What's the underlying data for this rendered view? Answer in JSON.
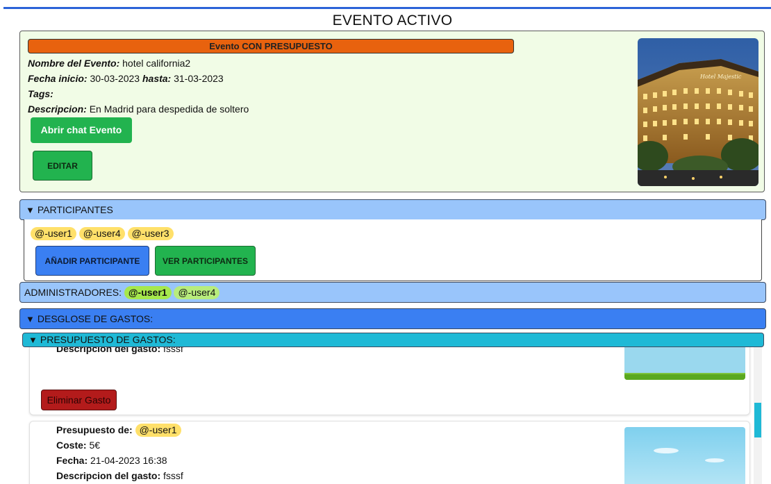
{
  "page_title": "EVENTO ACTIVO",
  "event": {
    "budget_banner": "Evento CON PRESUPUESTO",
    "name_label": "Nombre del Evento:",
    "name_value": "hotel california2",
    "start_label": "Fecha inicio:",
    "start_value": "30-03-2023",
    "end_label": "hasta:",
    "end_value": "31-03-2023",
    "tags_label": "Tags:",
    "desc_label": "Descripcion:",
    "desc_value": "En Madrid para despedida de soltero",
    "chat_button": "Abrir chat Evento",
    "edit_button": "EDITAR",
    "photo_sign": "Hotel Majestic"
  },
  "participants": {
    "header": "PARTICIPANTES",
    "users": [
      "@-user1",
      "@-user4",
      "@-user3"
    ],
    "add_button": "AÑADIR PARTICIPANTE",
    "see_button": "VER PARTICIPANTES"
  },
  "admins": {
    "label": "ADMINISTRADORES:",
    "users": [
      "@-user1",
      "@-user4"
    ]
  },
  "expenses": {
    "breakdown_header": "DESGLOSE DE GASTOS:",
    "budget_header": "PRESUPUESTO DE GASTOS:",
    "card1": {
      "desc_label": "Descripcion del gasto:",
      "desc_value": "fsssf",
      "delete_button": "Eliminar Gasto"
    },
    "card2": {
      "budget_label": "Presupuesto de:",
      "budget_user": "@-user1",
      "cost_label": "Coste:",
      "cost_value": "5€",
      "date_label": "Fecha:",
      "date_value": "21-04-2023 16:38",
      "desc_label": "Descripcion del gasto:",
      "desc_value": "fsssf"
    }
  },
  "colors": {
    "accent_blue": "#3a7ff2",
    "light_blue": "#99c5fb",
    "cyan": "#1fb9d6",
    "green": "#22b34f",
    "orange": "#e8620e",
    "red": "#b31b1b",
    "pill_yellow": "#ffe06a",
    "pill_green": "#a6e84c"
  },
  "icons": {
    "expand": "triangle-down-icon"
  }
}
